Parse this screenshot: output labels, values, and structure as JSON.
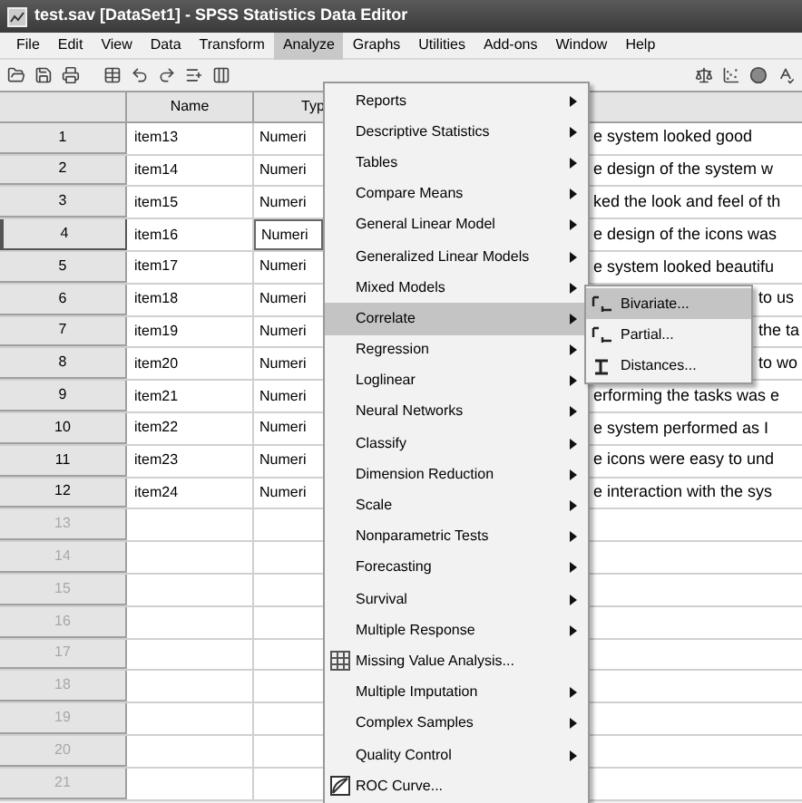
{
  "window": {
    "title": "test.sav [DataSet1] - SPSS Statistics Data Editor"
  },
  "menu_bar": [
    {
      "label": "File",
      "selected": false
    },
    {
      "label": "Edit",
      "selected": false
    },
    {
      "label": "View",
      "selected": false
    },
    {
      "label": "Data",
      "selected": false
    },
    {
      "label": "Transform",
      "selected": false
    },
    {
      "label": "Analyze",
      "selected": true
    },
    {
      "label": "Graphs",
      "selected": false
    },
    {
      "label": "Utilities",
      "selected": false
    },
    {
      "label": "Add-ons",
      "selected": false
    },
    {
      "label": "Window",
      "selected": false
    },
    {
      "label": "Help",
      "selected": false
    }
  ],
  "table": {
    "columns": [
      "Name",
      "Typ"
    ],
    "rows": [
      {
        "number": "1",
        "filled": true,
        "selected": false,
        "name": "item13",
        "type": "Numeri",
        "label": "e system looked good"
      },
      {
        "number": "2",
        "filled": true,
        "selected": false,
        "name": "item14",
        "type": "Numeri",
        "label": "e design of the system w"
      },
      {
        "number": "3",
        "filled": true,
        "selected": false,
        "name": "item15",
        "type": "Numeri",
        "label": "ked the look and feel of th"
      },
      {
        "number": "4",
        "filled": true,
        "selected": true,
        "name": "item16",
        "type": "Numeri",
        "label": "e design of the icons was"
      },
      {
        "number": "5",
        "filled": true,
        "selected": false,
        "name": "item17",
        "type": "Numeri",
        "label": "e system looked beautifu"
      },
      {
        "number": "6",
        "filled": true,
        "selected": false,
        "name": "item18",
        "type": "Numeri",
        "label": "to us"
      },
      {
        "number": "7",
        "filled": true,
        "selected": false,
        "name": "item19",
        "type": "Numeri",
        "label": "the ta"
      },
      {
        "number": "8",
        "filled": true,
        "selected": false,
        "name": "item20",
        "type": "Numeri",
        "label": "to wo"
      },
      {
        "number": "9",
        "filled": true,
        "selected": false,
        "name": "item21",
        "type": "Numeri",
        "label": "erforming the tasks was e"
      },
      {
        "number": "10",
        "filled": true,
        "selected": false,
        "name": "item22",
        "type": "Numeri",
        "label": "e system performed as I"
      },
      {
        "number": "11",
        "filled": true,
        "selected": false,
        "name": "item23",
        "type": "Numeri",
        "label": "e icons were easy to und"
      },
      {
        "number": "12",
        "filled": true,
        "selected": false,
        "name": "item24",
        "type": "Numeri",
        "label": "e interaction with the sys"
      },
      {
        "number": "13",
        "filled": false,
        "selected": false
      },
      {
        "number": "14",
        "filled": false,
        "selected": false
      },
      {
        "number": "15",
        "filled": false,
        "selected": false
      },
      {
        "number": "16",
        "filled": false,
        "selected": false
      },
      {
        "number": "17",
        "filled": false,
        "selected": false
      },
      {
        "number": "18",
        "filled": false,
        "selected": false
      },
      {
        "number": "19",
        "filled": false,
        "selected": false
      },
      {
        "number": "20",
        "filled": false,
        "selected": false
      },
      {
        "number": "21",
        "filled": false,
        "selected": false
      }
    ]
  },
  "analyze_menu": [
    {
      "label": "Reports",
      "kind": "submenu",
      "selected": false
    },
    {
      "label": "Descriptive Statistics",
      "kind": "submenu",
      "selected": false
    },
    {
      "label": "Tables",
      "kind": "submenu",
      "selected": false
    },
    {
      "label": "Compare Means",
      "kind": "submenu",
      "selected": false
    },
    {
      "label": "General Linear Model",
      "kind": "submenu",
      "selected": false
    },
    {
      "label": "Generalized Linear Models",
      "kind": "submenu",
      "selected": false
    },
    {
      "label": "Mixed Models",
      "kind": "submenu",
      "selected": false
    },
    {
      "label": "Correlate",
      "kind": "submenu",
      "selected": true
    },
    {
      "label": "Regression",
      "kind": "submenu",
      "selected": false
    },
    {
      "label": "Loglinear",
      "kind": "submenu",
      "selected": false
    },
    {
      "label": "Neural Networks",
      "kind": "submenu",
      "selected": false
    },
    {
      "label": "Classify",
      "kind": "submenu",
      "selected": false
    },
    {
      "label": "Dimension Reduction",
      "kind": "submenu",
      "selected": false
    },
    {
      "label": "Scale",
      "kind": "submenu",
      "selected": false
    },
    {
      "label": "Nonparametric Tests",
      "kind": "submenu",
      "selected": false
    },
    {
      "label": "Forecasting",
      "kind": "submenu",
      "selected": false
    },
    {
      "label": "Survival",
      "kind": "submenu",
      "selected": false
    },
    {
      "label": "Multiple Response",
      "kind": "submenu",
      "selected": false
    },
    {
      "label": "Missing Value Analysis...",
      "kind": "command",
      "selected": false
    },
    {
      "label": "Multiple Imputation",
      "kind": "submenu",
      "selected": false
    },
    {
      "label": "Complex Samples",
      "kind": "submenu",
      "selected": false
    },
    {
      "label": "Quality Control",
      "kind": "submenu",
      "selected": false
    },
    {
      "label": "ROC Curve...",
      "kind": "command",
      "selected": false
    }
  ],
  "correlate_submenu": [
    {
      "label": "Bivariate...",
      "selected": true
    },
    {
      "label": "Partial...",
      "selected": false
    },
    {
      "label": "Distances...",
      "selected": false
    }
  ]
}
